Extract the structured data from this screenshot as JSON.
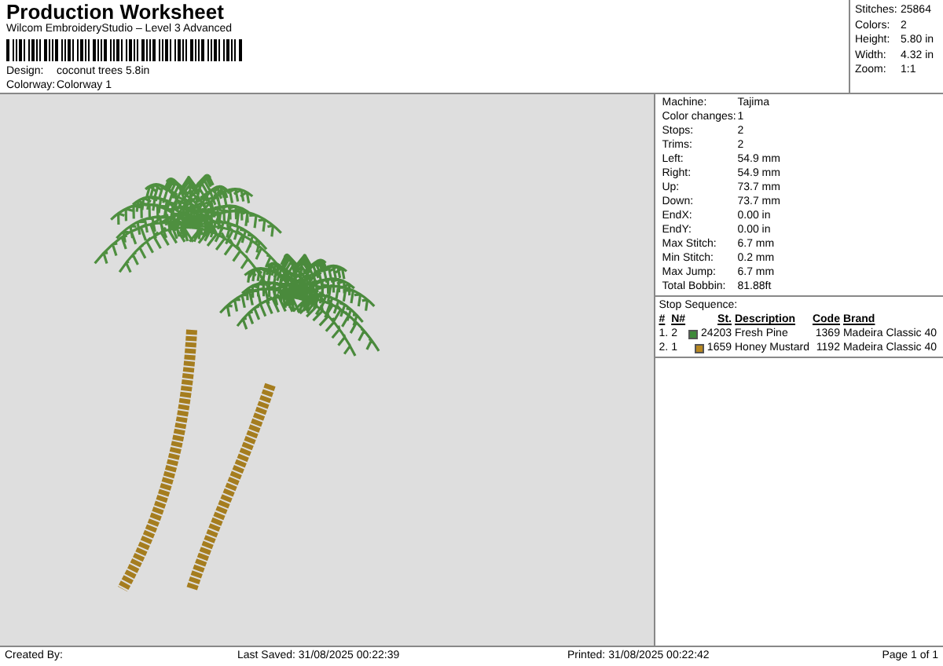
{
  "header": {
    "title": "Production Worksheet",
    "subtitle": "Wilcom EmbroideryStudio – Level 3 Advanced",
    "design_label": "Design:",
    "design": "coconut trees 5.8in",
    "colorway_label": "Colorway:",
    "colorway": "Colorway 1"
  },
  "summary": [
    {
      "label": "Stitches:",
      "value": "25864"
    },
    {
      "label": "Colors:",
      "value": "2"
    },
    {
      "label": "Height:",
      "value": "5.80 in"
    },
    {
      "label": "Width:",
      "value": "4.32 in"
    },
    {
      "label": "Zoom:",
      "value": "1:1"
    }
  ],
  "details": [
    {
      "label": "Machine:",
      "value": "Tajima"
    },
    {
      "label": "Color changes:",
      "value": "1"
    },
    {
      "label": "Stops:",
      "value": "2"
    },
    {
      "label": "Trims:",
      "value": "2"
    },
    {
      "label": "Left:",
      "value": "54.9 mm"
    },
    {
      "label": "Right:",
      "value": "54.9 mm"
    },
    {
      "label": "Up:",
      "value": "73.7 mm"
    },
    {
      "label": "Down:",
      "value": "73.7 mm"
    },
    {
      "label": "EndX:",
      "value": "0.00 in"
    },
    {
      "label": "EndY:",
      "value": "0.00 in"
    },
    {
      "label": "Max Stitch:",
      "value": "6.7 mm"
    },
    {
      "label": "Min Stitch:",
      "value": "0.2 mm"
    },
    {
      "label": "Max Jump:",
      "value": "6.7 mm"
    },
    {
      "label": "Total Bobbin:",
      "value": "81.88ft"
    }
  ],
  "stop_sequence": {
    "title": "Stop Sequence:",
    "columns": [
      "#",
      "N#",
      "St.",
      "Description",
      "Code",
      "Brand"
    ],
    "rows": [
      {
        "index": "1.",
        "needle": "2",
        "color": "#3f8a3a",
        "stitches": "24203",
        "description": "Fresh Pine",
        "code": "1369",
        "brand": "Madeira Classic 40"
      },
      {
        "index": "2.",
        "needle": "1",
        "color": "#b8871f",
        "stitches": "1659",
        "description": "Honey Mustard",
        "code": "1192",
        "brand": "Madeira Classic 40"
      }
    ]
  },
  "footer": {
    "created_by": "Created By:",
    "last_saved": "Last Saved: 31/08/2025 00:22:39",
    "printed": "Printed: 31/08/2025 00:22:42",
    "page": "Page 1 of 1"
  }
}
